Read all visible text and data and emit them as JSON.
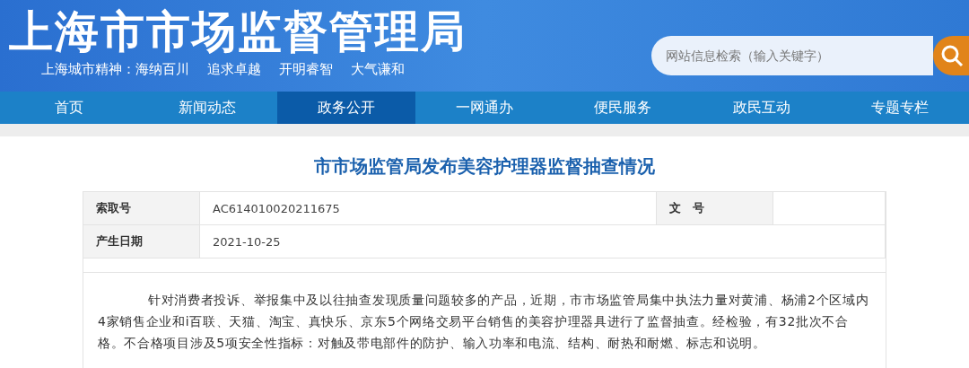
{
  "header": {
    "title": "上海市市场监督管理局",
    "motto": [
      "上海城市精神：海纳百川",
      "追求卓越",
      "开明睿智",
      "大气谦和"
    ],
    "search": {
      "placeholder": "网站信息检索（输入关键字）"
    }
  },
  "nav": [
    {
      "label": "首页",
      "selected": false
    },
    {
      "label": "新闻动态",
      "selected": false
    },
    {
      "label": "政务公开",
      "selected": true
    },
    {
      "label": "一网通办",
      "selected": false
    },
    {
      "label": "便民服务",
      "selected": false
    },
    {
      "label": "政民互动",
      "selected": false
    },
    {
      "label": "专题专栏",
      "selected": false
    }
  ],
  "article": {
    "title": "市市场监管局发布美容护理器监督抽查情况",
    "meta": [
      [
        {
          "label": "索取号",
          "value": "AC614010020211675"
        },
        {
          "label": "文　号"
        }
      ],
      [
        {
          "label": "产生日期",
          "value": "2021-10-25"
        }
      ]
    ],
    "body": "针对消费者投诉、举报集中及以往抽查发现质量问题较多的产品，近期，市市场监管局集中执法力量对黄浦、杨浦2个区域内4家销售企业和i百联、天猫、淘宝、真快乐、京东5个网络交易平台销售的美容护理器具进行了监督抽查。经检验，有32批次不合格。不合格项目涉及5项安全性指标：对触及带电部件的防护、输入功率和电流、结构、耐热和耐燃、标志和说明。"
  }
}
